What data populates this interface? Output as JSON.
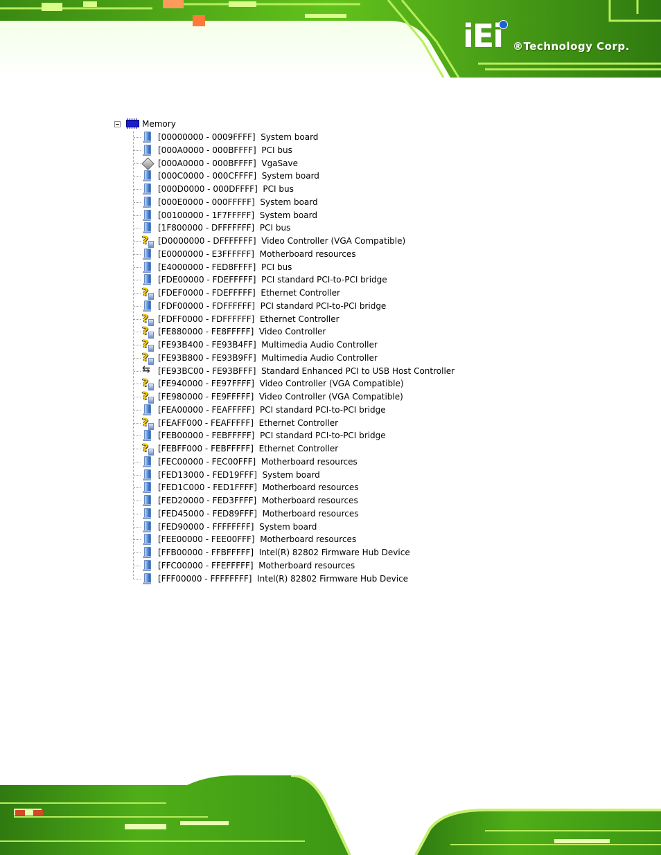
{
  "brand": {
    "logo_text": "iEi",
    "tagline": "®Technology Corp."
  },
  "tree": {
    "root": {
      "label": "Memory",
      "icon": "memory-icon",
      "expander": "minus"
    },
    "items": [
      {
        "range": "[00000000 - 0009FFFF]",
        "device": "System board",
        "icon": "monitor"
      },
      {
        "range": "[000A0000 - 000BFFFF]",
        "device": "PCI bus",
        "icon": "monitor"
      },
      {
        "range": "[000A0000 - 000BFFFF]",
        "device": "VgaSave",
        "icon": "diamond"
      },
      {
        "range": "[000C0000 - 000CFFFF]",
        "device": "System board",
        "icon": "monitor"
      },
      {
        "range": "[000D0000 - 000DFFFF]",
        "device": "PCI bus",
        "icon": "monitor"
      },
      {
        "range": "[000E0000 - 000FFFFF]",
        "device": "System board",
        "icon": "monitor"
      },
      {
        "range": "[00100000 - 1F7FFFFF]",
        "device": "System board",
        "icon": "monitor"
      },
      {
        "range": "[1F800000 - DFFFFFFF]",
        "device": "PCI bus",
        "icon": "monitor"
      },
      {
        "range": "[D0000000 - DFFFFFFF]",
        "device": "Video Controller (VGA Compatible)",
        "icon": "unknown"
      },
      {
        "range": "[E0000000 - E3FFFFFF]",
        "device": "Motherboard resources",
        "icon": "monitor"
      },
      {
        "range": "[E4000000 - FED8FFFF]",
        "device": "PCI bus",
        "icon": "monitor"
      },
      {
        "range": "[FDE00000 - FDEFFFFF]",
        "device": "PCI standard PCI-to-PCI bridge",
        "icon": "monitor"
      },
      {
        "range": "[FDEF0000 - FDEFFFFF]",
        "device": "Ethernet Controller",
        "icon": "unknown"
      },
      {
        "range": "[FDF00000 - FDFFFFFF]",
        "device": "PCI standard PCI-to-PCI bridge",
        "icon": "monitor"
      },
      {
        "range": "[FDFF0000 - FDFFFFFF]",
        "device": "Ethernet Controller",
        "icon": "unknown"
      },
      {
        "range": "[FE880000 - FE8FFFFF]",
        "device": "Video Controller",
        "icon": "unknown"
      },
      {
        "range": "[FE93B400 - FE93B4FF]",
        "device": "Multimedia Audio Controller",
        "icon": "unknown"
      },
      {
        "range": "[FE93B800 - FE93B9FF]",
        "device": "Multimedia Audio Controller",
        "icon": "unknown"
      },
      {
        "range": "[FE93BC00 - FE93BFFF]",
        "device": "Standard Enhanced PCI to USB Host Controller",
        "icon": "usb"
      },
      {
        "range": "[FE940000 - FE97FFFF]",
        "device": "Video Controller (VGA Compatible)",
        "icon": "unknown"
      },
      {
        "range": "[FE980000 - FE9FFFFF]",
        "device": "Video Controller (VGA Compatible)",
        "icon": "unknown"
      },
      {
        "range": "[FEA00000 - FEAFFFFF]",
        "device": "PCI standard PCI-to-PCI bridge",
        "icon": "monitor"
      },
      {
        "range": "[FEAFF000 - FEAFFFFF]",
        "device": "Ethernet Controller",
        "icon": "unknown"
      },
      {
        "range": "[FEB00000 - FEBFFFFF]",
        "device": "PCI standard PCI-to-PCI bridge",
        "icon": "monitor"
      },
      {
        "range": "[FEBFF000 - FEBFFFFF]",
        "device": "Ethernet Controller",
        "icon": "unknown"
      },
      {
        "range": "[FEC00000 - FEC00FFF]",
        "device": "Motherboard resources",
        "icon": "monitor"
      },
      {
        "range": "[FED13000 - FED19FFF]",
        "device": "System board",
        "icon": "monitor"
      },
      {
        "range": "[FED1C000 - FED1FFFF]",
        "device": "Motherboard resources",
        "icon": "monitor"
      },
      {
        "range": "[FED20000 - FED3FFFF]",
        "device": "Motherboard resources",
        "icon": "monitor"
      },
      {
        "range": "[FED45000 - FED89FFF]",
        "device": "Motherboard resources",
        "icon": "monitor"
      },
      {
        "range": "[FED90000 - FFFFFFFF]",
        "device": "System board",
        "icon": "monitor"
      },
      {
        "range": "[FEE00000 - FEE00FFF]",
        "device": "Motherboard resources",
        "icon": "monitor"
      },
      {
        "range": "[FFB00000 - FFBFFFFF]",
        "device": "Intel(R) 82802 Firmware Hub Device",
        "icon": "monitor"
      },
      {
        "range": "[FFC00000 - FFEFFFFF]",
        "device": "Motherboard resources",
        "icon": "monitor"
      },
      {
        "range": "[FFF00000 - FFFFFFFF]",
        "device": "Intel(R) 82802 Firmware Hub Device",
        "icon": "monitor"
      }
    ]
  },
  "colors": {
    "board_green": "#5fc01e",
    "board_dark": "#1f6a10",
    "trace": "#c8f070"
  }
}
